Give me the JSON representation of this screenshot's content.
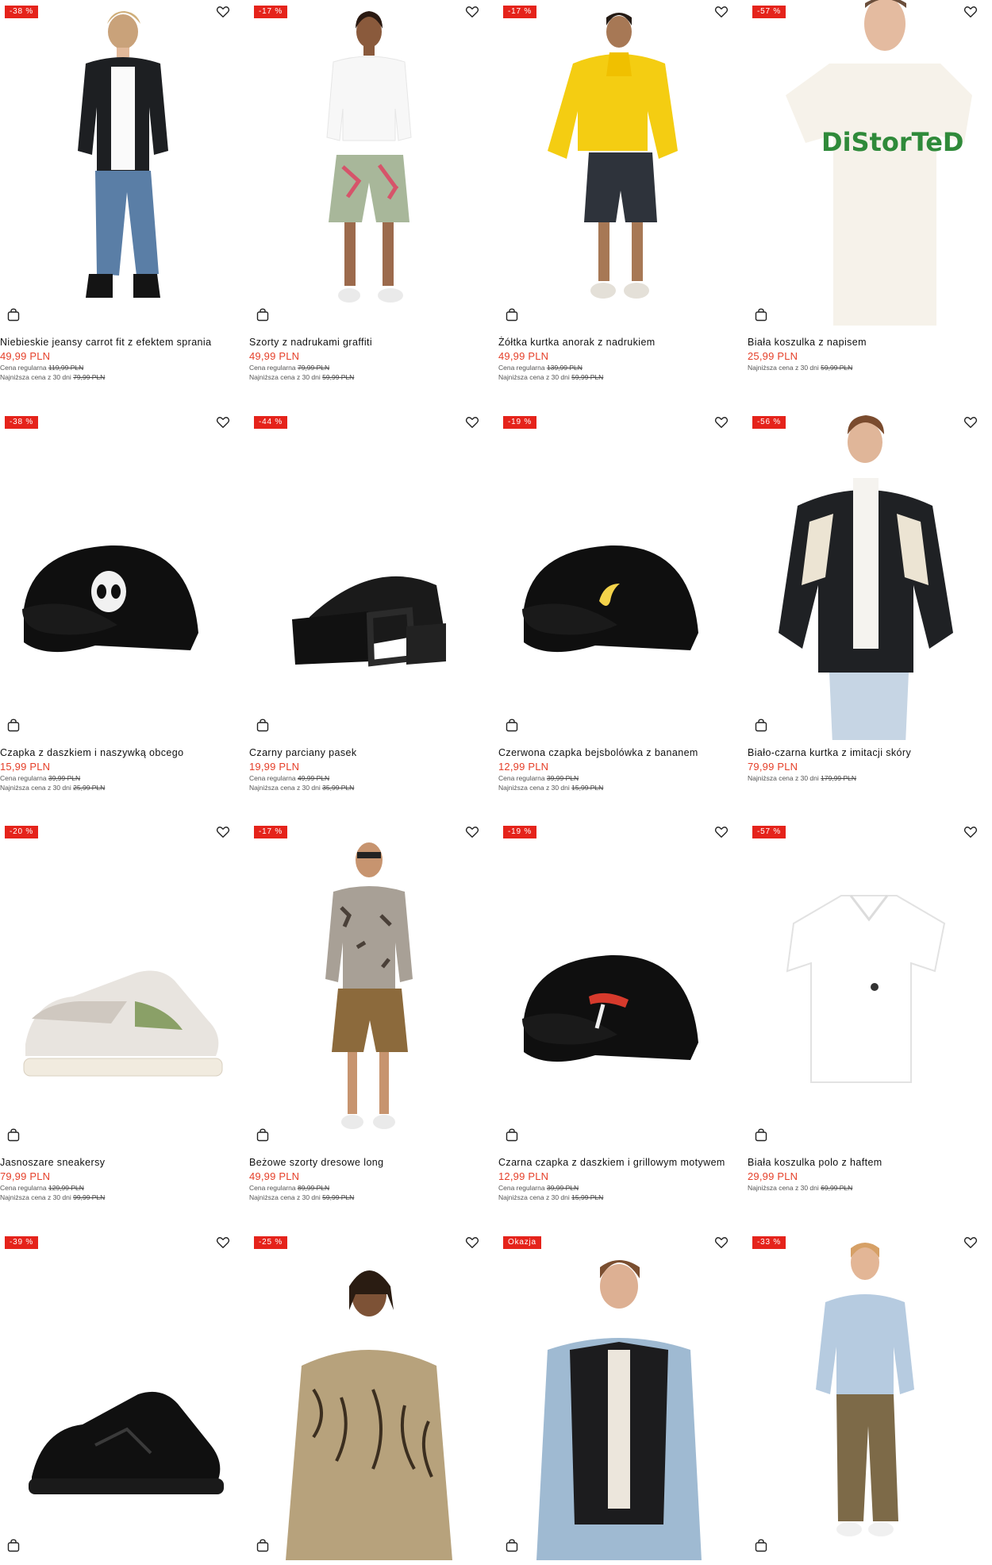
{
  "products": [
    {
      "badge": "-38 %",
      "name": "Niebieskie jeansy carrot fit z efektem sprania",
      "price": "49,99 PLN",
      "regular_label": "Cena regularna",
      "regular_price": "119,99 PLN",
      "lowest_label": "Najniższa cena z 30 dni",
      "lowest_price": "79,99 PLN",
      "illustration": "person-jacket-jeans"
    },
    {
      "badge": "-17 %",
      "name": "Szorty z nadrukami graffiti",
      "price": "49,99 PLN",
      "regular_label": "Cena regularna",
      "regular_price": "79,99 PLN",
      "lowest_label": "Najniższa cena z 30 dni",
      "lowest_price": "59,99 PLN",
      "illustration": "person-graffiti-shorts"
    },
    {
      "badge": "-17 %",
      "name": "Żółtka kurtka anorak z nadrukiem",
      "price": "49,99 PLN",
      "regular_label": "Cena regularna",
      "regular_price": "139,99 PLN",
      "lowest_label": "Najniższa cena z 30 dni",
      "lowest_price": "59,99 PLN",
      "illustration": "person-yellow-anorak"
    },
    {
      "badge": "-57 %",
      "name": "Biała koszulka z napisem",
      "price": "25,99 PLN",
      "regular_label": "",
      "regular_price": "",
      "lowest_label": "Najniższa cena z 30 dni",
      "lowest_price": "59,99 PLN",
      "illustration": "white-tshirt-print"
    },
    {
      "badge": "-38 %",
      "name": "Czapka z daszkiem i naszywką obcego",
      "price": "15,99 PLN",
      "regular_label": "Cena regularna",
      "regular_price": "39,99 PLN",
      "lowest_label": "Najniższa cena z 30 dni",
      "lowest_price": "25,99 PLN",
      "illustration": "cap-alien"
    },
    {
      "badge": "-44 %",
      "name": "Czarny parciany pasek",
      "price": "19,99 PLN",
      "regular_label": "Cena regularna",
      "regular_price": "49,99 PLN",
      "lowest_label": "Najniższa cena z 30 dni",
      "lowest_price": "35,99 PLN",
      "illustration": "belt"
    },
    {
      "badge": "-19 %",
      "name": "Czerwona czapka bejsbolówka z bananem",
      "price": "12,99 PLN",
      "regular_label": "Cena regularna",
      "regular_price": "39,99 PLN",
      "lowest_label": "Najniższa cena z 30 dni",
      "lowest_price": "15,99 PLN",
      "illustration": "cap-banana"
    },
    {
      "badge": "-56 %",
      "name": "Biało-czarna kurtka z imitacji skóry",
      "price": "79,99 PLN",
      "regular_label": "",
      "regular_price": "",
      "lowest_label": "Najniższa cena z 30 dni",
      "lowest_price": "179,99 PLN",
      "illustration": "person-leather-jacket"
    },
    {
      "badge": "-20 %",
      "name": "Jasnoszare sneakersy",
      "price": "79,99 PLN",
      "regular_label": "Cena regularna",
      "regular_price": "129,99 PLN",
      "lowest_label": "Najniższa cena z 30 dni",
      "lowest_price": "99,99 PLN",
      "illustration": "sneaker-light"
    },
    {
      "badge": "-17 %",
      "name": "Beżowe szorty dresowe long",
      "price": "49,99 PLN",
      "regular_label": "Cena regularna",
      "regular_price": "89,99 PLN",
      "lowest_label": "Najniższa cena z 30 dni",
      "lowest_price": "59,99 PLN",
      "illustration": "person-cargo-shorts"
    },
    {
      "badge": "-19 %",
      "name": "Czarna czapka z daszkiem i grillowym motywem",
      "price": "12,99 PLN",
      "regular_label": "Cena regularna",
      "regular_price": "39,99 PLN",
      "lowest_label": "Najniższa cena z 30 dni",
      "lowest_price": "15,99 PLN",
      "illustration": "cap-grill"
    },
    {
      "badge": "-57 %",
      "name": "Biała koszulka polo z haftem",
      "price": "29,99 PLN",
      "regular_label": "",
      "regular_price": "",
      "lowest_label": "Najniższa cena z 30 dni",
      "lowest_price": "69,99 PLN",
      "illustration": "polo-white"
    },
    {
      "badge": "-39 %",
      "name": "",
      "price": "",
      "regular_label": "",
      "regular_price": "",
      "lowest_label": "",
      "lowest_price": "",
      "illustration": "sneaker-black"
    },
    {
      "badge": "-25 %",
      "name": "",
      "price": "",
      "regular_label": "",
      "regular_price": "",
      "lowest_label": "",
      "lowest_price": "",
      "illustration": "person-patterned-shirt"
    },
    {
      "badge": "Okazja",
      "name": "",
      "price": "",
      "regular_label": "",
      "regular_price": "",
      "lowest_label": "",
      "lowest_price": "",
      "illustration": "person-vest-denim"
    },
    {
      "badge": "-33 %",
      "name": "",
      "price": "",
      "regular_label": "",
      "regular_price": "",
      "lowest_label": "",
      "lowest_price": "",
      "illustration": "person-denim-jacket"
    }
  ],
  "icons": {
    "wishlist": "heart-outline-icon",
    "cart": "shopping-bag-icon"
  },
  "colors": {
    "badge": "#e5231b",
    "price": "#e5402a"
  }
}
